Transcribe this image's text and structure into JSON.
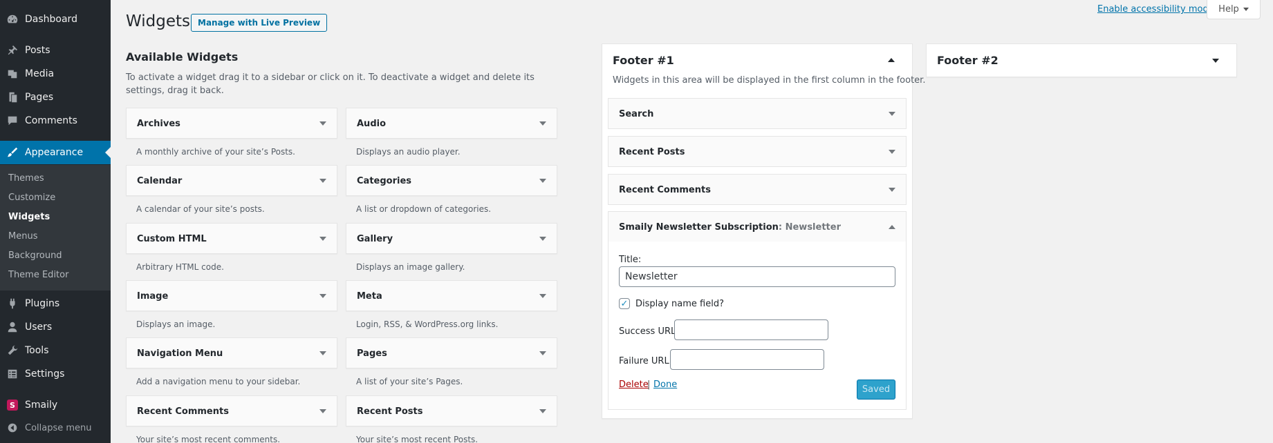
{
  "admin_menu": {
    "items": [
      {
        "label": "Dashboard",
        "icon": "dashboard-icon"
      },
      {
        "label": "Posts",
        "icon": "pin-icon"
      },
      {
        "label": "Media",
        "icon": "media-icon"
      },
      {
        "label": "Pages",
        "icon": "pages-icon"
      },
      {
        "label": "Comments",
        "icon": "comment-icon"
      },
      {
        "label": "Appearance",
        "icon": "brush-icon"
      },
      {
        "label": "Plugins",
        "icon": "plug-icon"
      },
      {
        "label": "Users",
        "icon": "user-icon"
      },
      {
        "label": "Tools",
        "icon": "wrench-icon"
      },
      {
        "label": "Settings",
        "icon": "settings-icon"
      },
      {
        "label": "Smaily",
        "icon": "smaily-logo-icon"
      }
    ],
    "submenu": [
      "Themes",
      "Customize",
      "Widgets",
      "Menus",
      "Background",
      "Theme Editor"
    ],
    "collapse_label": "Collapse menu",
    "smaily_glyph": "S"
  },
  "header": {
    "title": "Widgets",
    "live_preview_button": "Manage with Live Preview",
    "accessibility_link": "Enable accessibility mode",
    "help_label": "Help"
  },
  "available": {
    "title": "Available Widgets",
    "description": "To activate a widget drag it to a sidebar or click on it. To deactivate a widget and delete its settings, drag it back.",
    "widgets": [
      {
        "name": "Archives",
        "desc": "A monthly archive of your site’s Posts."
      },
      {
        "name": "Audio",
        "desc": "Displays an audio player."
      },
      {
        "name": "Calendar",
        "desc": "A calendar of your site’s posts."
      },
      {
        "name": "Categories",
        "desc": "A list or dropdown of categories."
      },
      {
        "name": "Custom HTML",
        "desc": "Arbitrary HTML code."
      },
      {
        "name": "Gallery",
        "desc": "Displays an image gallery."
      },
      {
        "name": "Image",
        "desc": "Displays an image."
      },
      {
        "name": "Meta",
        "desc": "Login, RSS, & WordPress.org links."
      },
      {
        "name": "Navigation Menu",
        "desc": "Add a navigation menu to your sidebar."
      },
      {
        "name": "Pages",
        "desc": "A list of your site’s Pages."
      },
      {
        "name": "Recent Comments",
        "desc": "Your site’s most recent comments."
      },
      {
        "name": "Recent Posts",
        "desc": "Your site’s most recent Posts."
      }
    ]
  },
  "footer1": {
    "title": "Footer #1",
    "description": "Widgets in this area will be displayed in the first column in the footer.",
    "widgets": [
      "Search",
      "Recent Posts",
      "Recent Comments"
    ],
    "open_widget": {
      "name": "Smaily Newsletter Subscription",
      "instance": ": Newsletter",
      "title_label": "Title:",
      "title_value": "Newsletter",
      "checkbox_label": "Display name field?",
      "checkbox_checked": true,
      "success_label": "Success URL:",
      "success_value": "",
      "failure_label": "Failure URL:",
      "failure_value": "",
      "delete_label": "Delete",
      "separator": "|",
      "done_label": "Done",
      "saved_label": "Saved"
    }
  },
  "footer2": {
    "title": "Footer #2"
  },
  "colors": {
    "menu_bg": "#23282d",
    "submenu_bg": "#32373c",
    "accent": "#0073aa",
    "saved_button": "#2ea2cc",
    "delete_link": "#aa0000"
  }
}
